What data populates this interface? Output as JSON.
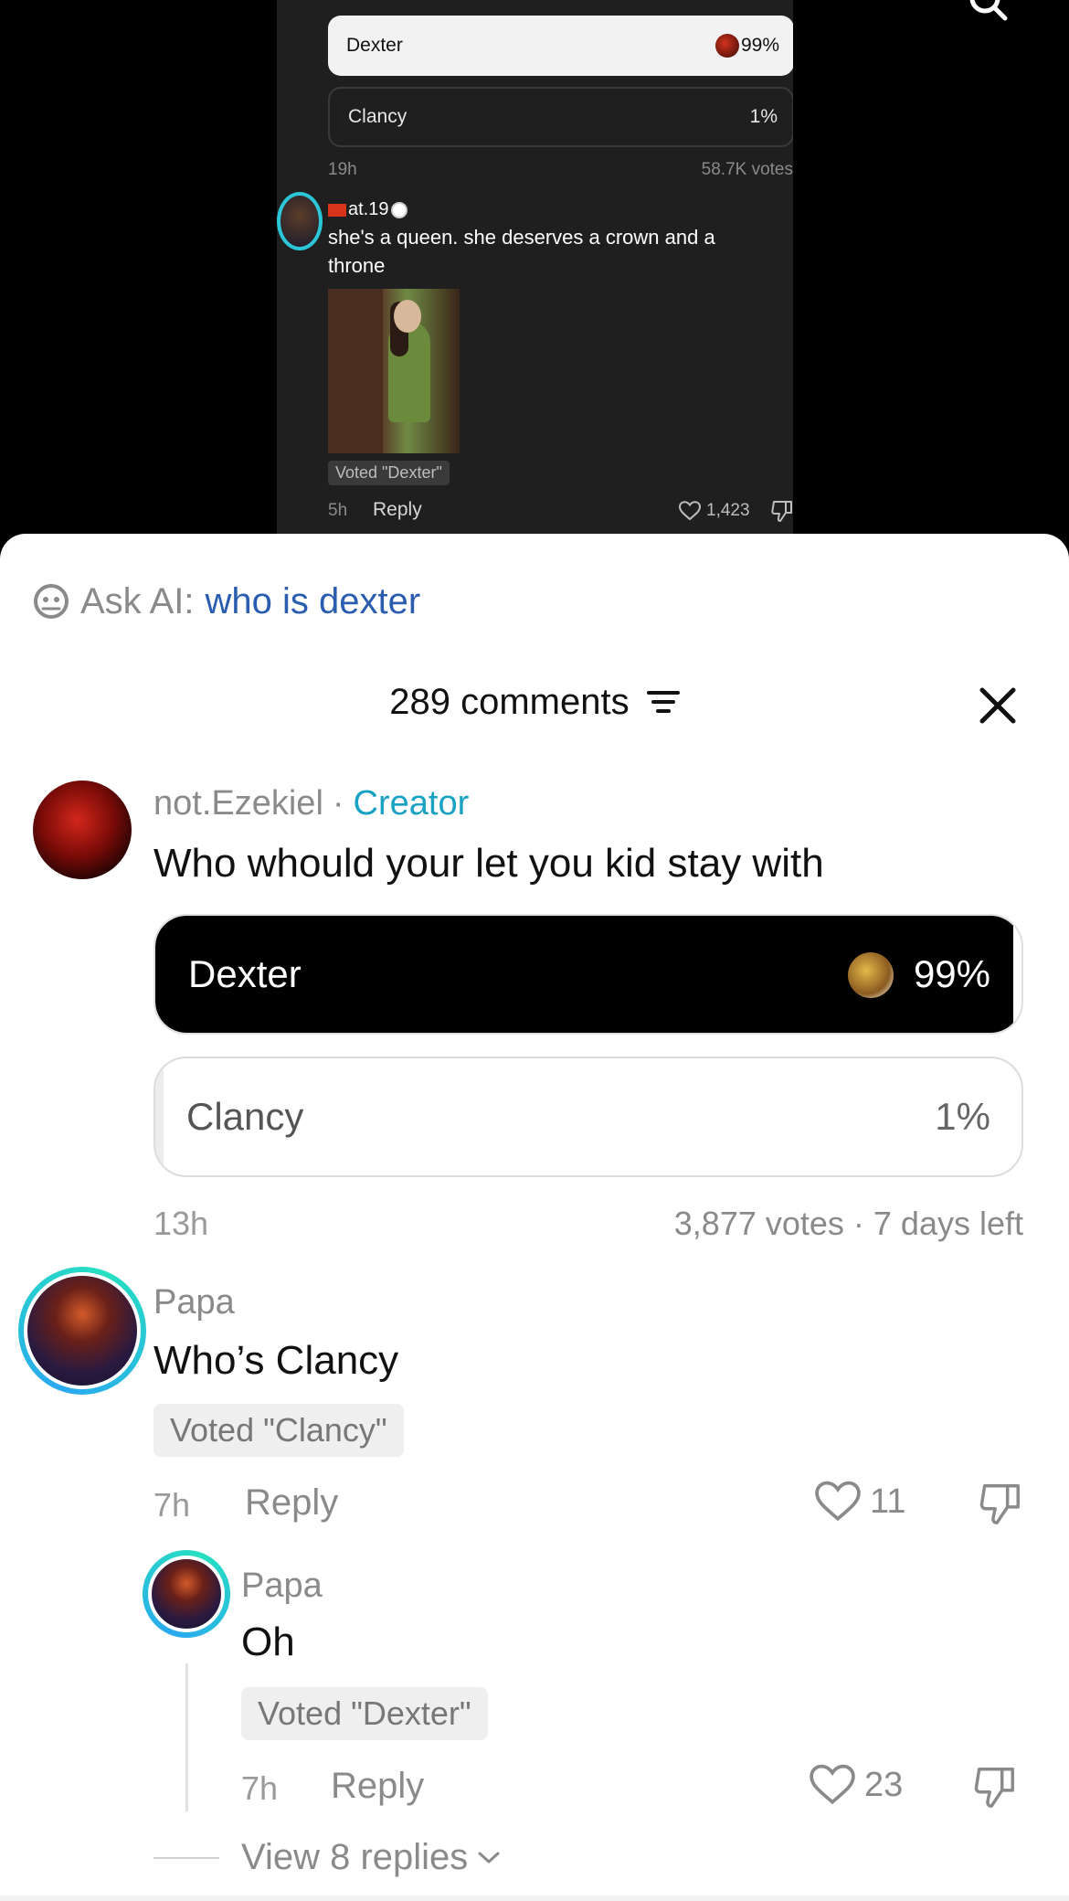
{
  "video": {
    "poll": {
      "options": [
        {
          "label": "Dexter",
          "percent": "99%"
        },
        {
          "label": "Clancy",
          "percent": "1%"
        }
      ],
      "time": "19h",
      "votes": "58.7K votes"
    },
    "comment": {
      "user": "at.19",
      "text": "she's a queen. she deserves a crown and a throne",
      "voted": "Voted \"Dexter\"",
      "time": "5h",
      "reply": "Reply",
      "likes": "1,423"
    }
  },
  "ask_ai": {
    "label": "Ask AI:",
    "query": "who is dexter"
  },
  "header": {
    "count": "289 comments"
  },
  "creator_comment": {
    "author": "not.Ezekiel",
    "separator": "·",
    "badge": "Creator",
    "text": "Who whould your let you kid stay with",
    "poll": {
      "options": [
        {
          "label": "Dexter",
          "percent": "99%",
          "fill_fraction": 0.99
        },
        {
          "label": "Clancy",
          "percent": "1%",
          "fill_fraction": 0.01
        }
      ]
    },
    "time": "13h",
    "meta": "3,877 votes · 7 days left"
  },
  "papa_comment": {
    "author": "Papa",
    "text": "Who’s Clancy",
    "voted": "Voted \"Clancy\"",
    "time": "7h",
    "reply": "Reply",
    "likes": "11"
  },
  "papa_reply": {
    "author": "Papa",
    "text": "Oh",
    "voted": "Voted \"Dexter\"",
    "time": "7h",
    "reply": "Reply",
    "likes": "23"
  },
  "view_replies": "View 8 replies",
  "colors": {
    "creator_badge": "#1aa2c4",
    "ask_ai_query": "#2a5cb0",
    "poll_selected": "#000000",
    "avatar_ring": "#26e0c0"
  }
}
